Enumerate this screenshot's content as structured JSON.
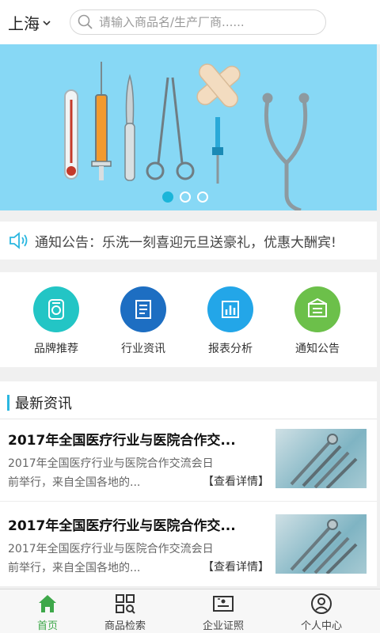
{
  "header": {
    "city": "上海",
    "search_placeholder": "请输入商品名/生产厂商......"
  },
  "banner": {
    "slide_count": 3,
    "active_index": 0,
    "background": "#87d8f5"
  },
  "notice": {
    "text": "通知公告：乐洗一刻喜迎元旦送豪礼，优惠大酬宾!"
  },
  "menu": {
    "items": [
      {
        "label": "品牌推荐",
        "icon": "medal-icon",
        "color": "#23c5c5"
      },
      {
        "label": "行业资讯",
        "icon": "document-icon",
        "color": "#1d6ec2"
      },
      {
        "label": "报表分析",
        "icon": "bar-chart-icon",
        "color": "#23a6e8"
      },
      {
        "label": "通知公告",
        "icon": "envelope-icon",
        "color": "#6cc04a"
      }
    ]
  },
  "news": {
    "section_title": "最新资讯",
    "items": [
      {
        "title": "2017年全国医疗行业与医院合作交...",
        "summary_line1": "2017年全国医疗行业与医院合作交流会日",
        "summary_line2": "前举行，来自全国各地的...",
        "more": "【查看详情】"
      },
      {
        "title": "2017年全国医疗行业与医院合作交...",
        "summary_line1": "2017年全国医疗行业与医院合作交流会日",
        "summary_line2": "前举行，来自全国各地的...",
        "more": "【查看详情】"
      }
    ]
  },
  "tabbar": {
    "items": [
      {
        "label": "首页",
        "icon": "home-icon",
        "active": true
      },
      {
        "label": "商品检索",
        "icon": "grid-search-icon",
        "active": false
      },
      {
        "label": "企业证照",
        "icon": "license-icon",
        "active": false
      },
      {
        "label": "个人中心",
        "icon": "user-icon",
        "active": false
      }
    ],
    "active_color": "#3ea84a"
  }
}
